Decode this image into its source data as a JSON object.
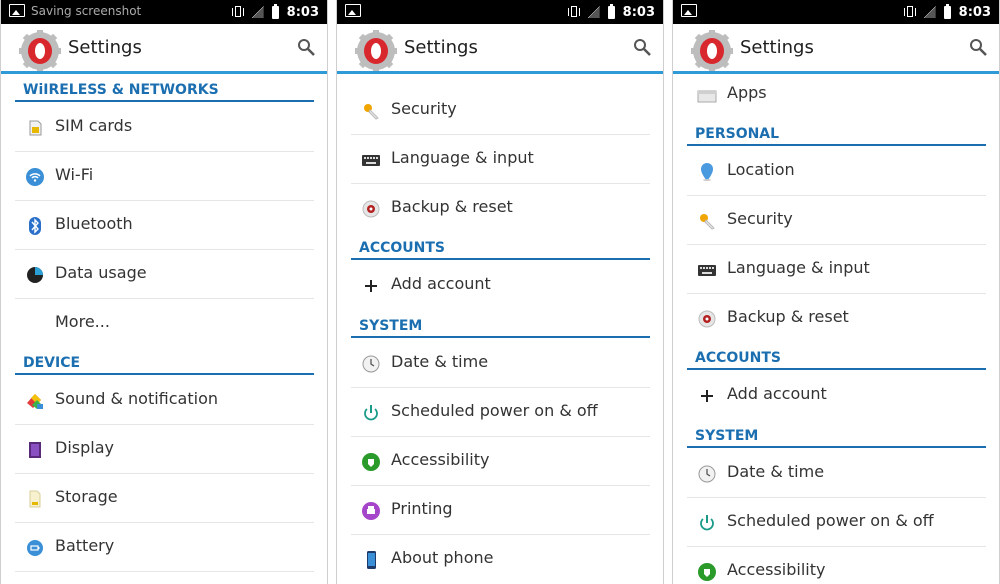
{
  "panels": [
    {
      "status": {
        "title": "Saving screenshot",
        "time": "8:03"
      },
      "app_title": "Settings",
      "sections": [
        {
          "label": "WiIRELESS & NETWORKS"
        },
        {
          "label": "DEVICE"
        }
      ],
      "items": [
        {
          "label": "SIM cards",
          "icon": "sim-card-icon"
        },
        {
          "label": "Wi-Fi",
          "icon": "wifi-icon"
        },
        {
          "label": "Bluetooth",
          "icon": "bluetooth-icon"
        },
        {
          "label": "Data usage",
          "icon": "data-usage-icon"
        },
        {
          "label": "More...",
          "icon": ""
        },
        {
          "label": "Sound & notification",
          "icon": "sound-icon"
        },
        {
          "label": "Display",
          "icon": "display-icon"
        },
        {
          "label": "Storage",
          "icon": "storage-icon"
        },
        {
          "label": "Battery",
          "icon": "battery-icon"
        }
      ]
    },
    {
      "status": {
        "title": "",
        "time": "8:03"
      },
      "app_title": "Settings",
      "sections": [
        {
          "label": "ACCOUNTS"
        },
        {
          "label": "SYSTEM"
        }
      ],
      "items": [
        {
          "label": "Security",
          "icon": "security-key-icon"
        },
        {
          "label": "Language & input",
          "icon": "keyboard-icon"
        },
        {
          "label": "Backup & reset",
          "icon": "backup-icon"
        },
        {
          "label": "Add account",
          "icon": "plus-icon"
        },
        {
          "label": "Date & time",
          "icon": "clock-icon"
        },
        {
          "label": "Scheduled power on & off",
          "icon": "power-icon"
        },
        {
          "label": "Accessibility",
          "icon": "accessibility-icon"
        },
        {
          "label": "Printing",
          "icon": "print-icon"
        },
        {
          "label": "About phone",
          "icon": "phone-icon"
        }
      ]
    },
    {
      "status": {
        "title": "",
        "time": "8:03"
      },
      "app_title": "Settings",
      "sections": [
        {
          "label": "PERSONAL"
        },
        {
          "label": "ACCOUNTS"
        },
        {
          "label": "SYSTEM"
        }
      ],
      "items": [
        {
          "label": "Apps",
          "icon": "apps-icon"
        },
        {
          "label": "Location",
          "icon": "location-icon"
        },
        {
          "label": "Security",
          "icon": "security-key-icon"
        },
        {
          "label": "Language & input",
          "icon": "keyboard-icon"
        },
        {
          "label": "Backup & reset",
          "icon": "backup-icon"
        },
        {
          "label": "Add account",
          "icon": "plus-icon"
        },
        {
          "label": "Date & time",
          "icon": "clock-icon"
        },
        {
          "label": "Scheduled power on & off",
          "icon": "power-icon"
        },
        {
          "label": "Accessibility",
          "icon": "accessibility-icon"
        }
      ]
    }
  ],
  "colors": {
    "accent_line": "#2e9bd6",
    "section": "#1b6fb0",
    "logo_red": "#d8282e"
  }
}
